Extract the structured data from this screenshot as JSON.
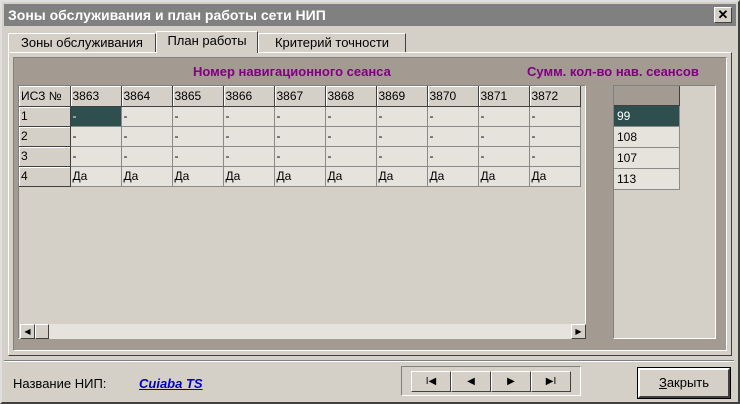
{
  "window": {
    "title": "Зоны обслуживания и план работы сети НИП",
    "close_glyph": "✕"
  },
  "tabs": [
    {
      "label": "Зоны обслуживания",
      "active": false
    },
    {
      "label": "План работы",
      "active": true
    },
    {
      "label": "Критерий точности",
      "active": false
    }
  ],
  "headers": {
    "session_number": "Номер навигационного сеанса",
    "sum_sessions": "Сумм. кол-во нав. сеансов"
  },
  "grid": {
    "corner": "ИСЗ №",
    "columns": [
      "3863",
      "3864",
      "3865",
      "3866",
      "3867",
      "3868",
      "3869",
      "3870",
      "3871",
      "3872"
    ],
    "rows": [
      {
        "id": "1",
        "cells": [
          "-",
          "-",
          "-",
          "-",
          "-",
          "-",
          "-",
          "-",
          "-",
          "-"
        ]
      },
      {
        "id": "2",
        "cells": [
          "-",
          "-",
          "-",
          "-",
          "-",
          "-",
          "-",
          "-",
          "-",
          "-"
        ]
      },
      {
        "id": "3",
        "cells": [
          "-",
          "-",
          "-",
          "-",
          "-",
          "-",
          "-",
          "-",
          "-",
          "-"
        ]
      },
      {
        "id": "4",
        "cells": [
          "Да",
          "Да",
          "Да",
          "Да",
          "Да",
          "Да",
          "Да",
          "Да",
          "Да",
          "Да"
        ]
      }
    ]
  },
  "sums": [
    "99",
    "108",
    "107",
    "113"
  ],
  "footer": {
    "station_label": "Название НИП:",
    "station_value": "Cuiaba TS",
    "close_button": "Закрыть",
    "close_underline": "З",
    "close_rest": "акрыть"
  },
  "nav": {
    "first": "I◀",
    "prev": "◀",
    "next": "▶",
    "last": "▶I"
  }
}
